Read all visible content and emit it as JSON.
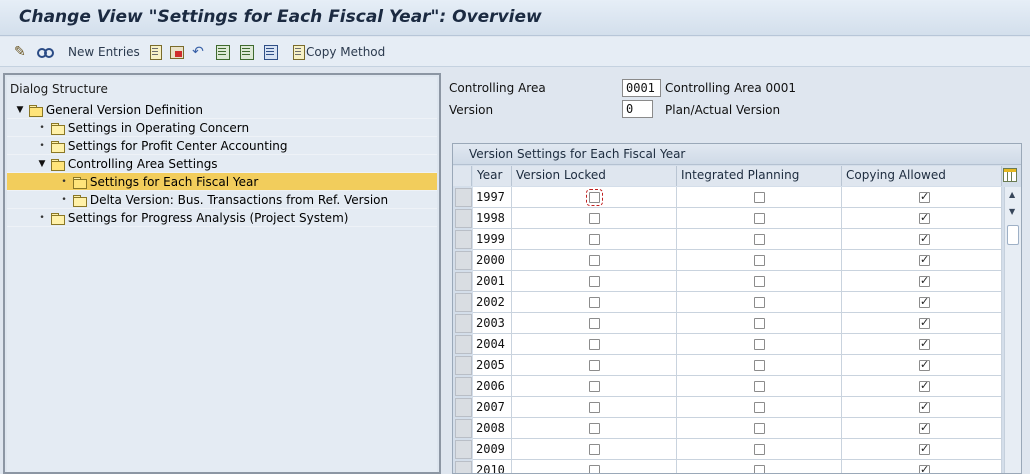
{
  "title": "Change View \"Settings for Each Fiscal Year\": Overview",
  "toolbar": {
    "new_entries": "New Entries",
    "copy_method": "Copy Method"
  },
  "dialog": {
    "header": "Dialog Structure",
    "items": [
      {
        "label": "General Version Definition"
      },
      {
        "label": "Settings in Operating Concern"
      },
      {
        "label": "Settings for Profit Center Accounting"
      },
      {
        "label": "Controlling Area Settings"
      },
      {
        "label": "Settings for Each Fiscal Year"
      },
      {
        "label": "Delta Version: Bus. Transactions from Ref. Version"
      },
      {
        "label": "Settings for Progress Analysis (Project System)"
      }
    ]
  },
  "fields": {
    "controlling_area_label": "Controlling Area",
    "controlling_area_value": "0001",
    "controlling_area_text": "Controlling Area 0001",
    "version_label": "Version",
    "version_value": "0",
    "version_text": "Plan/Actual Version"
  },
  "table": {
    "title": "Version Settings for Each Fiscal Year",
    "columns": [
      "Year",
      "Version Locked",
      "Integrated Planning",
      "Copying Allowed"
    ],
    "rows": [
      {
        "year": "1997",
        "locked": false,
        "integrated": false,
        "copying": true
      },
      {
        "year": "1998",
        "locked": false,
        "integrated": false,
        "copying": true
      },
      {
        "year": "1999",
        "locked": false,
        "integrated": false,
        "copying": true
      },
      {
        "year": "2000",
        "locked": false,
        "integrated": false,
        "copying": true
      },
      {
        "year": "2001",
        "locked": false,
        "integrated": false,
        "copying": true
      },
      {
        "year": "2002",
        "locked": false,
        "integrated": false,
        "copying": true
      },
      {
        "year": "2003",
        "locked": false,
        "integrated": false,
        "copying": true
      },
      {
        "year": "2004",
        "locked": false,
        "integrated": false,
        "copying": true
      },
      {
        "year": "2005",
        "locked": false,
        "integrated": false,
        "copying": true
      },
      {
        "year": "2006",
        "locked": false,
        "integrated": false,
        "copying": true
      },
      {
        "year": "2007",
        "locked": false,
        "integrated": false,
        "copying": true
      },
      {
        "year": "2008",
        "locked": false,
        "integrated": false,
        "copying": true
      },
      {
        "year": "2009",
        "locked": false,
        "integrated": false,
        "copying": true
      },
      {
        "year": "2010",
        "locked": false,
        "integrated": false,
        "copying": true
      }
    ]
  },
  "icons": {
    "toolbar": [
      "pencil-glasses-icon",
      "glasses-icon",
      "copy-icon",
      "delete-icon",
      "undo-icon",
      "select-all-icon",
      "select-block-icon",
      "deselect-all-icon",
      "copy-method-icon"
    ],
    "grid": "table-settings-icon"
  },
  "colors": {
    "selected_row": "#f2cd5c",
    "background": "#dfe6ef"
  }
}
